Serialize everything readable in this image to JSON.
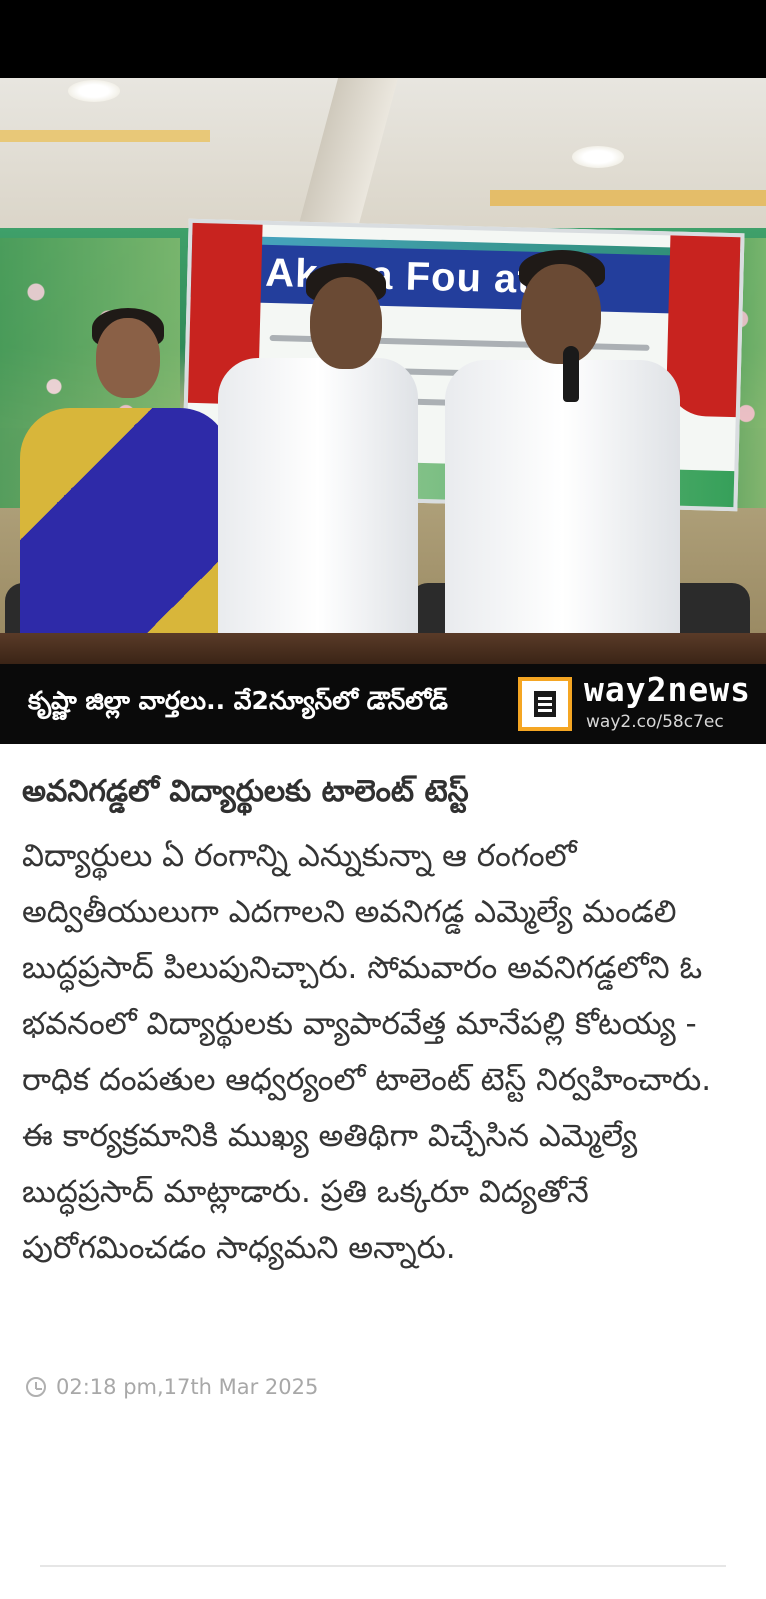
{
  "photo": {
    "banner_text": "Ak   ara Fou   ation",
    "alt": "news photo"
  },
  "promo": {
    "text": "కృష్ణా జిల్లా వార్తలు.. వే2న్యూస్‌లో డౌన్‌లోడ్",
    "brand_name": "way2news",
    "brand_url": "way2.co/58c7ec"
  },
  "article": {
    "headline": "అవనిగడ్డలో విద్యార్థులకు టాలెంట్ టెస్ట్",
    "body": "విద్యార్థులు ఏ రంగాన్ని ఎన్నుకున్నా ఆ రంగంలో అద్వితీయులుగా ఎదగాలని అవనిగడ్డ ఎమ్మెల్యే మండలి బుద్ధప్రసాద్ పిలుపునిచ్చారు. సోమవారం అవనిగడ్డలోని ఓ భవనంలో విద్యార్థులకు వ్యాపారవేత్త మానేపల్లి కోటయ్య - రాధిక దంపతుల ఆధ్వర్యంలో టాలెంట్ టెస్ట్ నిర్వహించారు. ఈ కార్యక్రమానికి ముఖ్య అతిథిగా విచ్చేసిన ఎమ్మెల్యే బుద్ధప్రసాద్ మాట్లాడారు. ప్రతి ఒక్కరూ విద్యతోనే పురోగమించడం సాధ్యమని అన్నారు.",
    "timestamp": "02:18 pm,17th Mar 2025"
  },
  "colors": {
    "accent": "#f5a623",
    "promo_bg": "#0a0a0a",
    "headline": "#303030",
    "timestamp": "#a8a8a8"
  }
}
